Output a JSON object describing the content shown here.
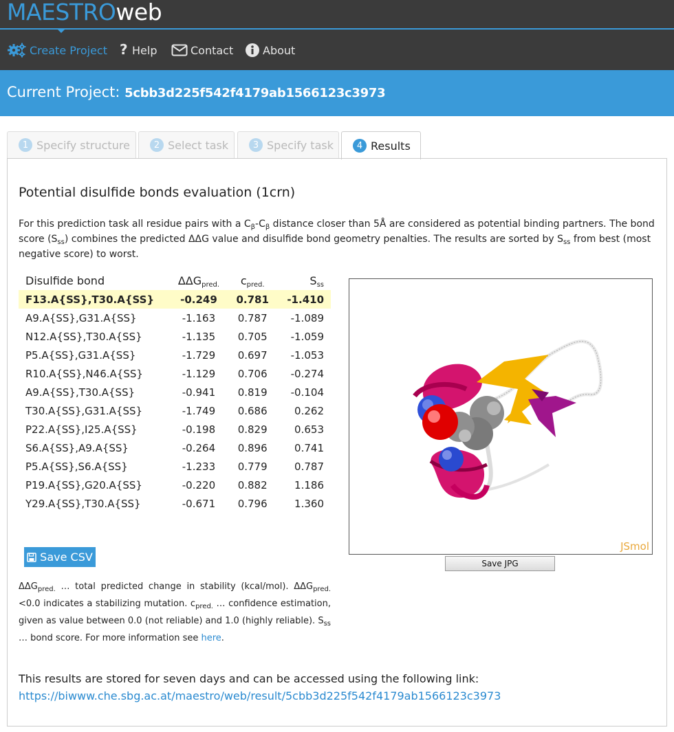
{
  "brand": {
    "part1": "MAESTRO",
    "part2": "web"
  },
  "nav": {
    "create": "Create Project",
    "help": "Help",
    "contact": "Contact",
    "about": "About"
  },
  "banner": {
    "label": "Current Project: ",
    "project_id": "5cbb3d225f542f4179ab1566123c3973"
  },
  "tabs": [
    {
      "num": "1",
      "label": "Specify structure"
    },
    {
      "num": "2",
      "label": "Select task"
    },
    {
      "num": "3",
      "label": "Specify task"
    },
    {
      "num": "4",
      "label": "Results"
    }
  ],
  "results": {
    "title": "Potential disulfide bonds evaluation (1crn)",
    "desc": {
      "p1": "For this prediction task all residue pairs with a C",
      "sub_beta": "β",
      "dash": "-C",
      "p2": " distance closer than 5Å are considered as potential binding partners. The bond score (S",
      "sub_ss": "ss",
      "p3": ") combines the predicted ΔΔG value and disulfide bond geometry penalties. The results are sorted by S",
      "p4": " from best (most negative score) to worst."
    },
    "columns": {
      "bond": "Disulfide bond",
      "ddg": "ΔΔG",
      "ddg_sub": "pred.",
      "c": "c",
      "c_sub": "pred.",
      "s": "S",
      "s_sub": "ss"
    },
    "rows": [
      {
        "bond": "F13.A{SS},T30.A{SS}",
        "ddg": "-0.249",
        "c": "0.781",
        "s": "-1.410"
      },
      {
        "bond": "A9.A{SS},G31.A{SS}",
        "ddg": "-1.163",
        "c": "0.787",
        "s": "-1.089"
      },
      {
        "bond": "N12.A{SS},T30.A{SS}",
        "ddg": "-1.135",
        "c": "0.705",
        "s": "-1.059"
      },
      {
        "bond": "P5.A{SS},G31.A{SS}",
        "ddg": "-1.729",
        "c": "0.697",
        "s": "-1.053"
      },
      {
        "bond": "R10.A{SS},N46.A{SS}",
        "ddg": "-1.129",
        "c": "0.706",
        "s": "-0.274"
      },
      {
        "bond": "A9.A{SS},T30.A{SS}",
        "ddg": "-0.941",
        "c": "0.819",
        "s": "-0.104"
      },
      {
        "bond": "T30.A{SS},G31.A{SS}",
        "ddg": "-1.749",
        "c": "0.686",
        "s": "0.262"
      },
      {
        "bond": "P22.A{SS},I25.A{SS}",
        "ddg": "-0.198",
        "c": "0.829",
        "s": "0.653"
      },
      {
        "bond": "S6.A{SS},A9.A{SS}",
        "ddg": "-0.264",
        "c": "0.896",
        "s": "0.741"
      },
      {
        "bond": "P5.A{SS},S6.A{SS}",
        "ddg": "-1.233",
        "c": "0.779",
        "s": "0.787"
      },
      {
        "bond": "P19.A{SS},G20.A{SS}",
        "ddg": "-0.220",
        "c": "0.882",
        "s": "1.186"
      },
      {
        "bond": "Y29.A{SS},T30.A{SS}",
        "ddg": "-0.671",
        "c": "0.796",
        "s": "1.360"
      }
    ],
    "save_csv": "Save CSV",
    "save_jpg": "Save JPG",
    "viewer_label": "JSmol",
    "legend": {
      "ddg": "ΔΔG",
      "pred": "pred.",
      "t1": " … total predicted change in stability (kcal/mol). ",
      "t2": "<0.0 indicates a stabilizing mutation. ",
      "c": "c",
      "t3": " … confidence estimation, given as value between 0.0 (not reliable) and 1.0 (highly reliable). ",
      "s": "S",
      "ss": "ss",
      "t4": " … bond score. For more information see ",
      "link": "here",
      "end": "."
    },
    "stored_text": "This results are stored for seven days and can be accessed using the following link:",
    "stored_link": "https://biwww.che.sbg.ac.at/maestro/web/result/5cbb3d225f542f4179ab1566123c3973"
  },
  "colors": {
    "accent": "#3a9ad9",
    "topbar": "#3b3b3b",
    "highlight_row": "#fffcc8"
  }
}
